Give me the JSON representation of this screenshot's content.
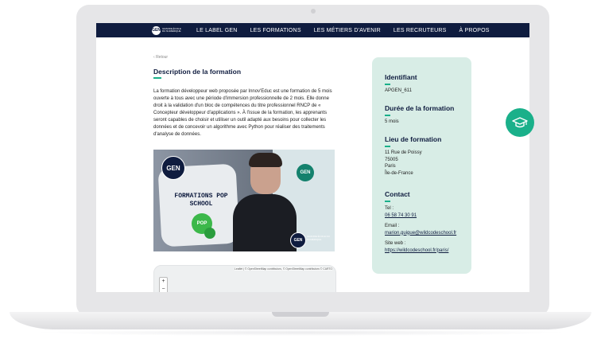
{
  "nav": {
    "logo_text": "GEN",
    "logo_subtext": "GRANDE ÉCOLE DU NUMÉRIQUE",
    "items": [
      "LE LABEL GEN",
      "LES FORMATIONS",
      "LES MÉTIERS D'AVENIR",
      "LES RECRUTEURS",
      "À PROPOS"
    ]
  },
  "main": {
    "back_label": "Retour",
    "title": "Description de la formation",
    "description": "La formation développeur web proposée par Innov'Educ est une formation de 5 mois ouverte à tous avec une période d'immersion professionnelle de 2 mois. Elle donne droit à la validation d'un bloc de compétences du titre professionnel RNCP de « Concepteur développeur d'applications ». À l'issue de la formation, les apprenants seront capables de choisir et utiliser un outil adapté aux besoins pour collecter les données et de concevoir un algorithme avec Python pour réaliser des traitements d'analyse de données.",
    "video": {
      "badge": "GEN",
      "headline": "FORMATIONS POP SCHOOL",
      "pop_label": "POP",
      "wall_logo": "GEN",
      "corner_logo": "GEN",
      "corner_text": "GRANDE ÉCOLE DU NUMÉRIQUE"
    },
    "map": {
      "attribution": "Leaflet | © OpenStreetMap contributors, © OpenStreetMap contributors © CARTO",
      "zoom_in": "+",
      "zoom_out": "−"
    }
  },
  "panel": {
    "identifier_label": "Identifiant",
    "identifier_value": "APGEN_611",
    "duration_label": "Durée de la formation",
    "duration_value": "5 mois",
    "location_label": "Lieu de formation",
    "address": [
      "11 Rue de Poissy",
      "75005",
      "Paris",
      "Île-de-France"
    ],
    "contact_label": "Contact",
    "tel_label": "Tel :",
    "tel_value": "06 58 74 30 91",
    "email_label": "Email :",
    "email_value": "marion.guigue@wildcodeschool.fr",
    "site_label": "Site web :",
    "site_value": "https://wildcodeschool.fr/paris/"
  },
  "fab": {
    "icon": "graduation-cap-icon"
  },
  "colors": {
    "nav": "#0f1c3f",
    "accent": "#1ab08a",
    "panel": "#d8ede6"
  }
}
